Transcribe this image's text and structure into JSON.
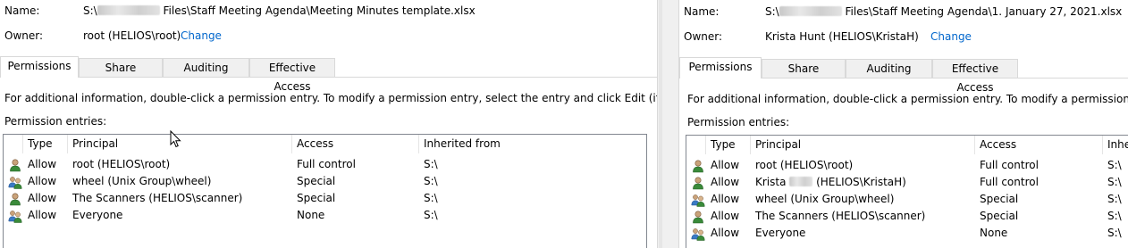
{
  "left": {
    "name_label": "Name:",
    "name_prefix": "S:\\",
    "name_suffix": " Files\\Staff Meeting Agenda\\Meeting Minutes template.xlsx",
    "owner_label": "Owner:",
    "owner_value": "root (HELIOS\\root)",
    "change_link": "Change",
    "tabs": [
      "Permissions",
      "Share",
      "Auditing",
      "Effective Access"
    ],
    "info_text": "For additional information, double-click a permission entry. To modify a permission entry, select the entry and click Edit (if available).",
    "entries_label": "Permission entries:",
    "columns": [
      "Type",
      "Principal",
      "Access",
      "Inherited from"
    ],
    "rows": [
      {
        "icon": "user-icon",
        "type": "Allow",
        "principal": "root (HELIOS\\root)",
        "access": "Full control",
        "inherited": "S:\\"
      },
      {
        "icon": "group-icon",
        "type": "Allow",
        "principal": "wheel (Unix Group\\wheel)",
        "access": "Special",
        "inherited": "S:\\"
      },
      {
        "icon": "user-icon",
        "type": "Allow",
        "principal": "The Scanners (HELIOS\\scanner)",
        "access": "Special",
        "inherited": "S:\\"
      },
      {
        "icon": "group-icon",
        "type": "Allow",
        "principal": "Everyone",
        "access": "None",
        "inherited": "S:\\"
      }
    ]
  },
  "right": {
    "name_label": "Name:",
    "name_prefix": "S:\\",
    "name_suffix": " Files\\Staff Meeting Agenda\\1. January 27, 2021.xlsx",
    "owner_label": "Owner:",
    "owner_value": "Krista Hunt (HELIOS\\KristaH)",
    "change_link": "Change",
    "tabs": [
      "Permissions",
      "Share",
      "Auditing",
      "Effective Access"
    ],
    "info_text": "For additional information, double-click a permission entry. To modify a permission entry, sele",
    "entries_label": "Permission entries:",
    "columns": [
      "Type",
      "Principal",
      "Access",
      "Inhe"
    ],
    "rows": [
      {
        "icon": "user-icon",
        "type": "Allow",
        "principal": "root (HELIOS\\root)",
        "access": "Full control",
        "inherited": "S:\\"
      },
      {
        "icon": "user-icon",
        "type": "Allow",
        "principal_first": "Krista",
        "principal_rest": " (HELIOS\\KristaH)",
        "access": "Full control",
        "inherited": "S:\\"
      },
      {
        "icon": "group-icon",
        "type": "Allow",
        "principal": "wheel (Unix Group\\wheel)",
        "access": "Special",
        "inherited": "S:\\"
      },
      {
        "icon": "user-icon",
        "type": "Allow",
        "principal": "The Scanners (HELIOS\\scanner)",
        "access": "Special",
        "inherited": "S:\\"
      },
      {
        "icon": "group-icon",
        "type": "Allow",
        "principal": "Everyone",
        "access": "None",
        "inherited": "S:\\"
      }
    ]
  },
  "colors": {
    "link": "#0066cc",
    "list_border": "#828790",
    "tab_bg": "#f0f0f0"
  }
}
